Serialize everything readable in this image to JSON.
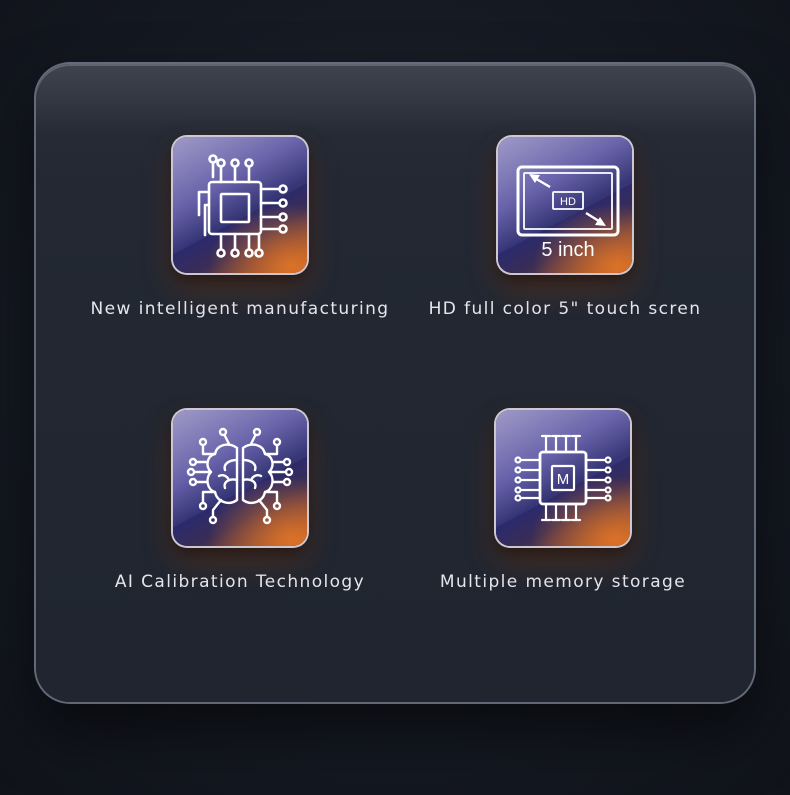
{
  "features": [
    {
      "caption": "New intelligent manufacturing",
      "icon": "chip-icon"
    },
    {
      "caption": "HD full color 5\" touch scren",
      "icon": "hd-screen-icon",
      "badge": "HD",
      "size_label": "5 inch"
    },
    {
      "caption": "AI Calibration Technology",
      "icon": "ai-brain-icon"
    },
    {
      "caption": "Multiple memory storage",
      "icon": "memory-chip-icon",
      "badge": "M"
    }
  ],
  "colors": {
    "background": "#151922",
    "panel": "#232833",
    "tile_purple": "#4a4399",
    "tile_orange": "#b5581e",
    "caption_text": "#e4e6ec"
  }
}
